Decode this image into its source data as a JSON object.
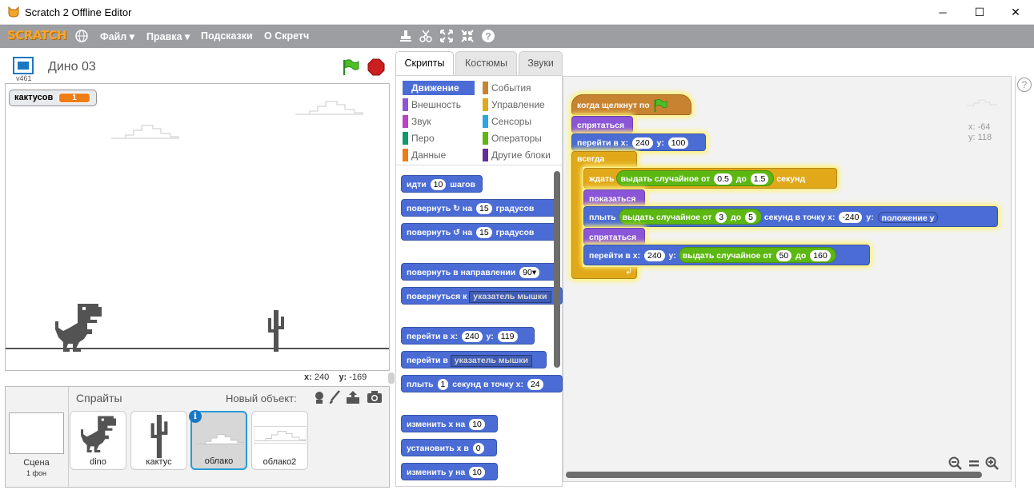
{
  "window": {
    "title": "Scratch 2 Offline Editor",
    "minimize": "─",
    "maximize": "☐",
    "close": "✕"
  },
  "menu": {
    "logo": "SCRATCH",
    "file": "Файл ▾",
    "edit": "Правка ▾",
    "tips": "Подсказки",
    "about": "О Скретч"
  },
  "stage_header": {
    "project_name": "Дино 03",
    "version": "v461"
  },
  "variable_monitor": {
    "label": "кактусов",
    "value": "1"
  },
  "coords": {
    "x_label": "x:",
    "x": "240",
    "y_label": "y:",
    "y": "-169"
  },
  "tabs": {
    "scripts": "Скрипты",
    "costumes": "Костюмы",
    "sounds": "Звуки"
  },
  "categories": {
    "left": [
      "Движение",
      "Внешность",
      "Звук",
      "Перо",
      "Данные"
    ],
    "right": [
      "События",
      "Управление",
      "Сенсоры",
      "Операторы",
      "Другие блоки"
    ],
    "left_colors": [
      "#4a6cd4",
      "#8a55d7",
      "#bb42c3",
      "#0e9a6c",
      "#ee7d16"
    ],
    "right_colors": [
      "#c88330",
      "#e1a91a",
      "#2ca5e2",
      "#5cb712",
      "#632d99"
    ]
  },
  "palette": {
    "move": "идти",
    "move_n": "10",
    "move_s": "шагов",
    "turn": "повернуть",
    "turn_on": "на",
    "turn_n": "15",
    "turn_s": "градусов",
    "point_dir": "повернуть в направлении",
    "point_dir_v": "90▾",
    "point_to": "повернуться к",
    "point_to_v": "указатель мышки",
    "goto_xy": "перейти в x:",
    "goto_x": "240",
    "goto_y_l": "y:",
    "goto_y": "119",
    "goto": "перейти в",
    "goto_v": "указатель мышки",
    "glide": "плыть",
    "glide_n": "1",
    "glide_s": "секунд в точку x:",
    "glide_x": "24",
    "change_x": "изменить x на",
    "change_x_v": "10",
    "set_x": "установить x в",
    "set_x_v": "0",
    "change_y": "изменить y на",
    "change_y_v": "10"
  },
  "script": {
    "hat": "когда щелкнут по",
    "hide1": "спрятаться",
    "goto1": "перейти в x:",
    "goto1_x": "240",
    "goto1_yl": "y:",
    "goto1_y": "100",
    "forever": "всегда",
    "wait": "ждать",
    "wait_rand": "выдать случайное от",
    "wait_a": "0.5",
    "wait_to": "до",
    "wait_b": "1.5",
    "wait_s": "секунд",
    "show": "показаться",
    "glide": "плыть",
    "glide_rand": "выдать случайное от",
    "glide_a": "3",
    "glide_to": "до",
    "glide_b": "5",
    "glide_s": "секунд в точку x:",
    "glide_x": "-240",
    "glide_yl": "y:",
    "glide_y": "положение y",
    "hide2": "спрятаться",
    "goto2": "перейти в x:",
    "goto2_x": "240",
    "goto2_yl": "y:",
    "goto2_rand": "выдать случайное от",
    "goto2_a": "50",
    "goto2_to": "до",
    "goto2_b": "160"
  },
  "script_coords": {
    "x": "x: -64",
    "y": "y: 118"
  },
  "sprites_pane": {
    "title": "Спрайты",
    "new_object": "Новый объект:",
    "stage_label": "Сцена",
    "stage_bg": "1 фон",
    "sprites": [
      "dino",
      "кактус",
      "облако",
      "облако2"
    ]
  }
}
